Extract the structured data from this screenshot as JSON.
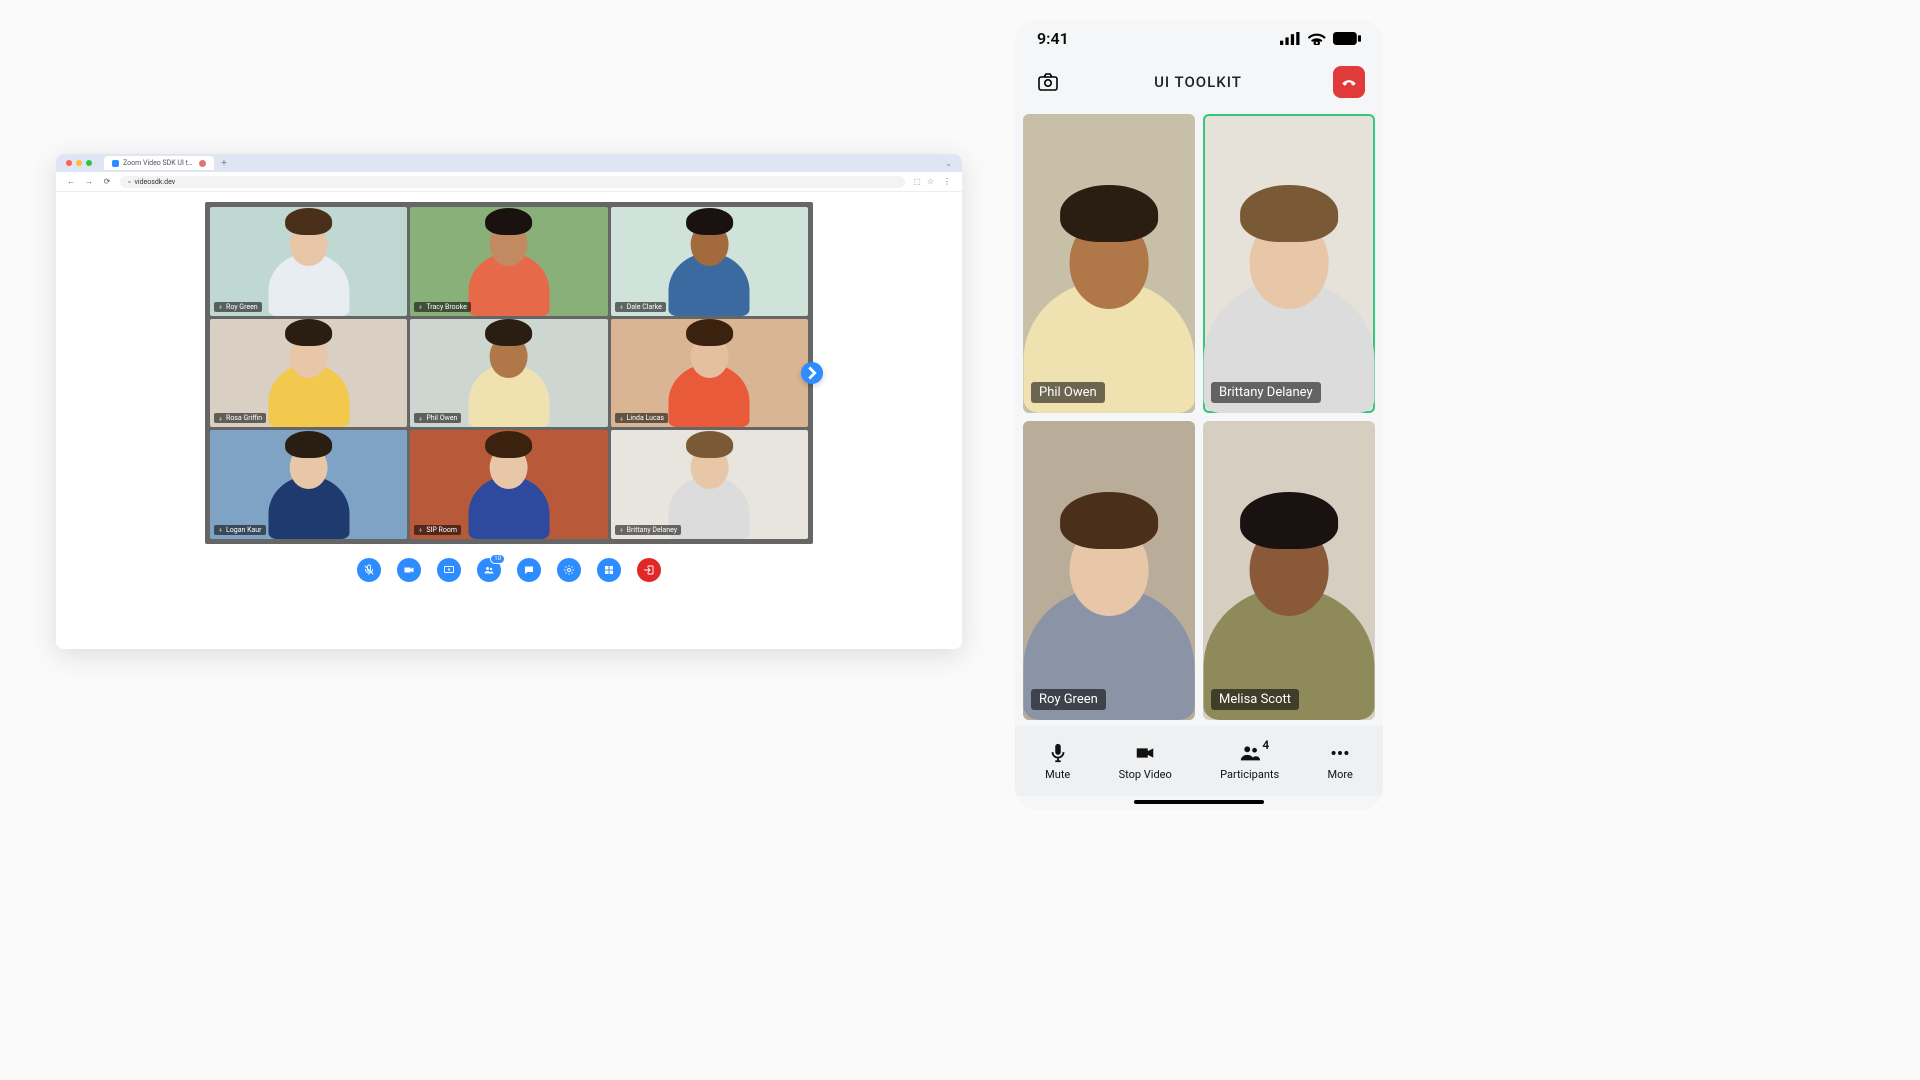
{
  "browser": {
    "tab_title": "Zoom Video SDK UI tool…",
    "url": "videosdk.dev",
    "grid": [
      {
        "name": "Roy Green",
        "muted": false,
        "bg": "#bfd8d2",
        "skin": "#e8c6a8",
        "shirt": "#e8edf1",
        "hair": "#4a2f1a"
      },
      {
        "name": "Tracy Brooke",
        "muted": false,
        "bg": "#8ab07a",
        "skin": "#c28a60",
        "shirt": "#e66a4a",
        "hair": "#1a1210"
      },
      {
        "name": "Dale Clarke",
        "muted": false,
        "bg": "#cfe3da",
        "skin": "#a36a3d",
        "shirt": "#3a6aa0",
        "hair": "#1a1210"
      },
      {
        "name": "Rosa Griffin",
        "muted": false,
        "bg": "#d9cfc2",
        "skin": "#e8c6a8",
        "shirt": "#f2c94c",
        "hair": "#2a1d12"
      },
      {
        "name": "Phil Owen",
        "muted": false,
        "bg": "#cdd6d0",
        "skin": "#b07748",
        "shirt": "#efe1b0",
        "hair": "#2a1d12"
      },
      {
        "name": "Linda Lucas",
        "muted": false,
        "bg": "#d9b593",
        "skin": "#e4bfa0",
        "shirt": "#e85a3a",
        "hair": "#3a220f"
      },
      {
        "name": "Logan Kaur",
        "muted": false,
        "bg": "#7fa3c4",
        "skin": "#e8c6a8",
        "shirt": "#1f3a6e",
        "hair": "#2a1d12"
      },
      {
        "name": "SIP Room",
        "muted": false,
        "bg": "#b85a3a",
        "skin": "#e8c6a8",
        "shirt": "#2e4a9e",
        "hair": "#3a220f"
      },
      {
        "name": "Brittany Delaney",
        "muted": false,
        "bg": "#e8e5df",
        "skin": "#e8c6a8",
        "shirt": "#dcdcdc",
        "hair": "#7a5a36"
      }
    ],
    "participant_badge": "10",
    "controls": {
      "mic": "mic-muted-icon",
      "camera": "camera-icon",
      "share": "share-screen-icon",
      "participants": "participants-icon",
      "chat": "chat-icon",
      "settings": "gear-icon",
      "view": "grid-view-icon",
      "leave": "leave-icon"
    }
  },
  "phone": {
    "time": "9:41",
    "title": "UI TOOLKIT",
    "tiles": [
      {
        "name": "Phil Owen",
        "active": false,
        "bg": "#c7bfa8",
        "skin": "#b07748",
        "shirt": "#efe1b0",
        "hair": "#2a1d12"
      },
      {
        "name": "Brittany Delaney",
        "active": true,
        "bg": "#e6e2da",
        "skin": "#e8c6a8",
        "shirt": "#dcdcdc",
        "hair": "#7a5a36"
      },
      {
        "name": "Roy Green",
        "active": false,
        "bg": "#b9ac98",
        "skin": "#e8c6a8",
        "shirt": "#8a94a6",
        "hair": "#4a2f1a"
      },
      {
        "name": "Melisa Scott",
        "active": false,
        "bg": "#d6cec0",
        "skin": "#8a5a38",
        "shirt": "#8f8a5a",
        "hair": "#1a1210"
      }
    ],
    "bottom": {
      "mute": "Mute",
      "stop_video": "Stop Video",
      "participants": "Participants",
      "participants_count": "4",
      "more": "More"
    }
  }
}
